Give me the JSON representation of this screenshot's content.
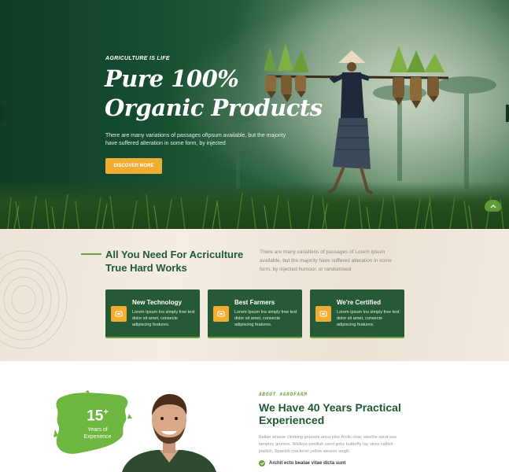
{
  "hero": {
    "eyebrow": "AGRICULTURE IS LIFE",
    "title_line1": "Pure 100%",
    "title_line2": "Organic Products",
    "description": "There are many variations of passages ofIpsum available, but the majority have suffered alteration in some form, by injected",
    "button_label": "DISCOVER MORE"
  },
  "features": {
    "title_line1": "All You Need For Acriculture",
    "title_line2": "True Hard Works",
    "description": "There are many variations of passages of Lorem Ipsum available, but the majority have suffered alteration in some form, by injected humour, or randomised",
    "cards": [
      {
        "title": "New Technology",
        "text": "Lorem Ipsum Ins simply free text dolor sit amet, consecte adipiscing features.",
        "icon": "tech-icon"
      },
      {
        "title": "Best Farmers",
        "text": "Lorem Ipsum Ins simply free text dolor sit amet, consecte adipiscing features.",
        "icon": "farmer-icon"
      },
      {
        "title": "We're Certified",
        "text": "Lorem Ipsum Ins simply free text dolor sit amet, consecte adipiscing features.",
        "icon": "certified-icon"
      }
    ]
  },
  "about": {
    "years_number": "15",
    "years_plus": "+",
    "years_label_line1": "Years of",
    "years_label_line2": "Experience",
    "eyebrow": "ABOUT AGROFARM",
    "title": "We Have 40 Years Practical Experienced",
    "description": "Ballan wrasse climbing gourami amur pike Arctic char, steelhe sprat sea lamprey grunion. Walleye poolfish sand goby butterfly ray stree catfish jewfish, Spanish mackerel yellow weaver sixgill.",
    "check_item": "Archit ecto beatae vitae dicta sunt"
  },
  "colors": {
    "brand_green": "#1f5a35",
    "accent_orange": "#f0ad31",
    "accent_lime": "#6da13f",
    "card_green": "#265a36"
  }
}
